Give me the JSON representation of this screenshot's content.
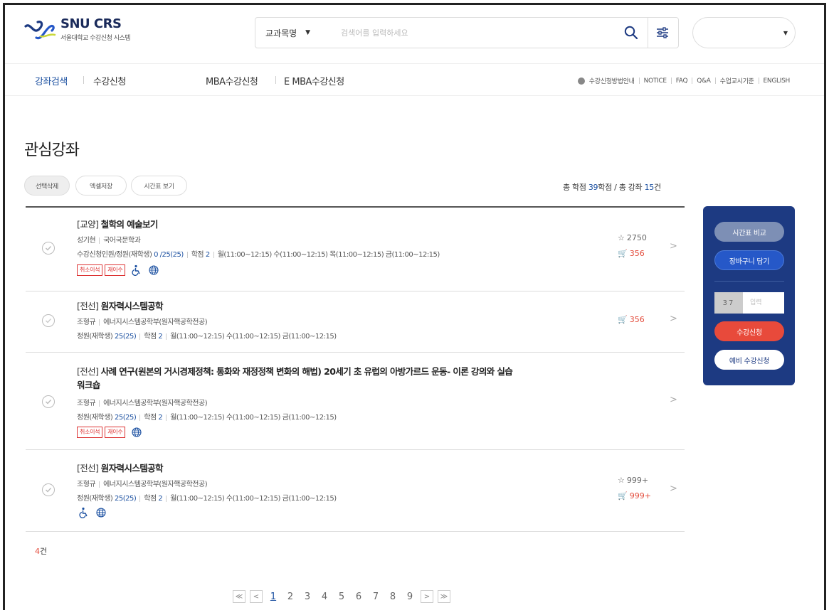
{
  "brand": {
    "title": "SNU CRS",
    "subtitle": "서울대학교 수강신청 시스템",
    "colors": {
      "navy": "#1d3a82",
      "blue": "#1a4fa0",
      "red": "#e34a3a",
      "logo_green": "#c9d83a"
    }
  },
  "search": {
    "category": "교과목명",
    "placeholder": "검색어를 입력하세요",
    "search_icon": "search-icon",
    "filter_icon": "filter-icon"
  },
  "user_select": {
    "value": ""
  },
  "nav": {
    "items": [
      "강좌검색",
      "수강신청",
      "MBA수강신청",
      "E MBA수강신청"
    ],
    "util": [
      "수강신청방법안내",
      "NOTICE",
      "FAQ",
      "Q&A",
      "수업교시기준",
      "ENGLISH"
    ]
  },
  "page": {
    "title": "관심강좌",
    "buttons": [
      "선택삭제",
      "엑셀저장",
      "시간표 보기"
    ],
    "totals": {
      "pre": "총 학점 ",
      "credits": "39",
      "mid": "학점 / 총 강좌 ",
      "courses": "15",
      "post": "건"
    }
  },
  "courses": [
    {
      "category": "[교양]",
      "name": "철학의 예술보기",
      "name_line2": "",
      "professor": "성기현",
      "dept": "국어국문학과",
      "enroll_label": "수강신청인원/정원(재학생)",
      "enroll_value": "0 /25(25)",
      "credit_label": "학점",
      "credit_value": "2",
      "schedule": "월(11:00~12:15) 수(11:00~12:15) 목(11:00~12:15) 금(11:00~12:15)",
      "tags": [
        "취소이석",
        "재이수"
      ],
      "icons": [
        "accessibility-icon",
        "globe-icon"
      ],
      "star": "2750",
      "cart": "356"
    },
    {
      "category": "[전선]",
      "name": "원자력시스템공학",
      "name_line2": "",
      "professor": "조형규",
      "dept": "에너지시스템공학부(원자핵공학전공)",
      "enroll_label": "정원(재학생)",
      "enroll_value": "25(25)",
      "credit_label": "학점",
      "credit_value": "2",
      "schedule": "월(11:00~12:15) 수(11:00~12:15) 금(11:00~12:15)",
      "tags": [],
      "icons": [],
      "star": "",
      "cart": "356"
    },
    {
      "category": "[전선]",
      "name": "사례 연구(원본의 거시경제정책: 통화와 재정정책 변화의 해법) 20세기 초 유럽의 아방가르드 운동- 이론 강의와 실습",
      "name_line2": "워크숍",
      "professor": "조형규",
      "dept": "에너지시스템공학부(원자핵공학전공)",
      "enroll_label": "정원(재학생)",
      "enroll_value": "25(25)",
      "credit_label": "학점",
      "credit_value": "2",
      "schedule": "월(11:00~12:15) 수(11:00~12:15) 금(11:00~12:15)",
      "tags": [
        "취소이석",
        "재이수"
      ],
      "icons": [
        "globe-icon"
      ],
      "star": "",
      "cart": ""
    },
    {
      "category": "[전선]",
      "name": "원자력시스템공학",
      "name_line2": "",
      "professor": "조형규",
      "dept": "에너지시스템공학부(원자핵공학전공)",
      "enroll_label": "정원(재학생)",
      "enroll_value": "25(25)",
      "credit_label": "학점",
      "credit_value": "2",
      "schedule": "월(11:00~12:15) 수(11:00~12:15) 금(11:00~12:15)",
      "tags": [],
      "icons": [
        "accessibility-icon",
        "globe-icon"
      ],
      "star": "999+",
      "cart": "999+"
    }
  ],
  "count": {
    "value": "4",
    "unit": "건"
  },
  "pager": {
    "first": "≪",
    "prev": "<",
    "pages": [
      "1",
      "2",
      "3",
      "4",
      "5",
      "6",
      "7",
      "8",
      "9"
    ],
    "active": "1",
    "next": ">",
    "last": "≫"
  },
  "panel": {
    "compare": "시간표 비교",
    "cart": "장바구니 담기",
    "captcha": "37",
    "captcha_placeholder": "입력",
    "apply": "수강신청",
    "pre_apply": "예비 수강신청"
  }
}
